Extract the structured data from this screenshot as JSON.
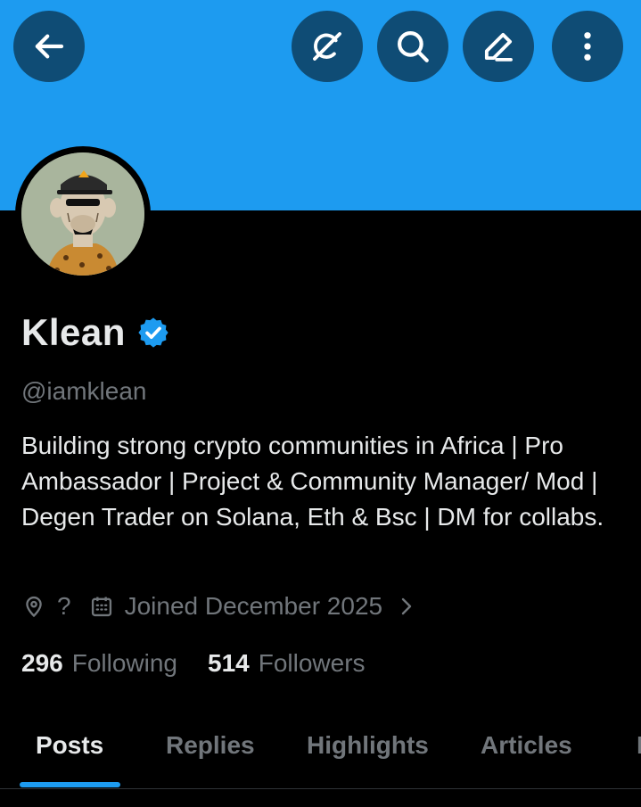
{
  "header": {
    "back_icon": "arrow-left-icon",
    "actions": [
      "grok-icon",
      "search-icon",
      "edit-icon",
      "more-vertical-icon"
    ]
  },
  "colors": {
    "banner": "#1d9bf0",
    "button_bg": "#0f4c75",
    "accent": "#1d9bf0",
    "muted": "#71767b",
    "text": "#e7e9ea"
  },
  "profile": {
    "display_name": "Klean",
    "verified": true,
    "handle": "@iamklean",
    "bio": "Building strong crypto communities in Africa | Pro Ambassador | Project & Community Manager/ Mod | Degen Trader on Solana, Eth & Bsc | DM for collabs.",
    "location": "?",
    "joined": "Joined December 2025"
  },
  "stats": {
    "following_count": "296",
    "following_label": "Following",
    "followers_count": "514",
    "followers_label": "Followers"
  },
  "tabs": {
    "posts": "Posts",
    "replies": "Replies",
    "highlights": "Highlights",
    "articles": "Articles",
    "media": "Media",
    "active": "Posts"
  }
}
